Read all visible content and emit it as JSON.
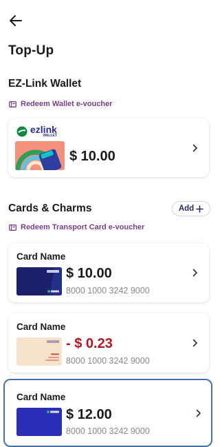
{
  "header": {
    "title": "Top-Up"
  },
  "wallet_section": {
    "title": "EZ-Link Wallet",
    "redeem_label": "Redeem Wallet e-voucher",
    "logo_text": "ezlink",
    "logo_sub": "WALLET",
    "balance": "$ 10.00"
  },
  "cards_section": {
    "title": "Cards & Charms",
    "add_label": "Add",
    "redeem_label": "Redeem Transport Card e-voucher"
  },
  "cards": [
    {
      "name": "Card Name",
      "balance": "$ 10.00",
      "number": "8000 1000 3242 9000",
      "balance_color": "#1a1a1a"
    },
    {
      "name": "Card Name",
      "balance": "- $ 0.23",
      "number": "8000 1000 3242 9000",
      "balance_color": "#b0171f"
    },
    {
      "name": "Card Name",
      "balance": "$ 12.00",
      "number": "8000 1000 3242 9000",
      "balance_color": "#1a1a1a"
    }
  ],
  "colors": {
    "accent_purple": "#7a3d87",
    "navy": "#232b5d",
    "negative": "#b0171f",
    "selected_border": "#4570a9"
  },
  "icons": [
    "back-arrow-icon",
    "voucher-icon",
    "chevron-right-icon",
    "plus-icon"
  ]
}
